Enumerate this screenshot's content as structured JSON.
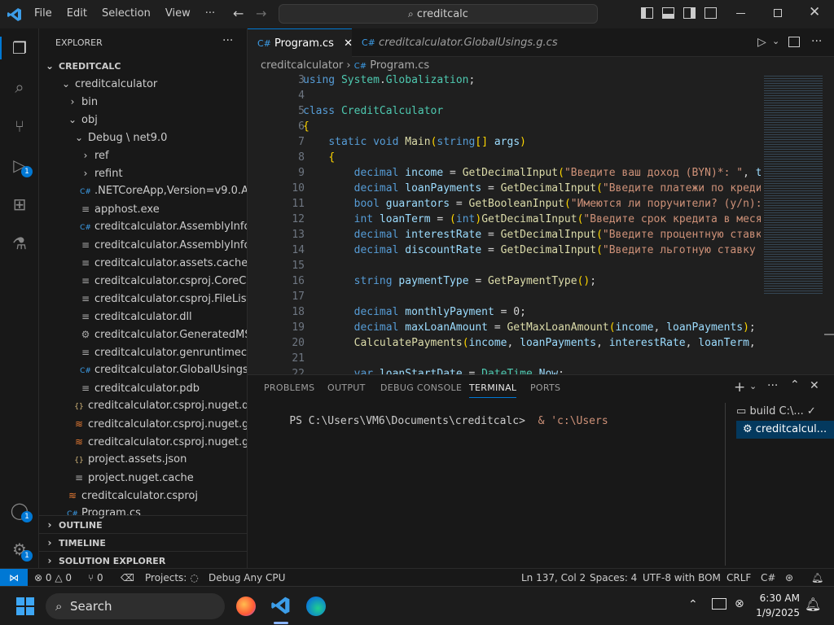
{
  "menu": {
    "file": "File",
    "edit": "Edit",
    "selection": "Selection",
    "view": "View",
    "more": "···"
  },
  "search": {
    "text": "creditcalc"
  },
  "explorer": {
    "title": "EXPLORER",
    "root": "CREDITCALC",
    "items": [
      {
        "label": "creditcalculator",
        "icon": "chevron-down-icon",
        "glyph": "⌄"
      },
      {
        "label": "bin",
        "icon": "chevron-right-icon",
        "glyph": "›"
      },
      {
        "label": "obj",
        "icon": "chevron-down-icon",
        "glyph": "⌄"
      },
      {
        "label": "Debug \\ net9.0",
        "icon": "chevron-down-icon",
        "glyph": "⌄"
      },
      {
        "label": "ref",
        "icon": "chevron-right-icon",
        "glyph": "›"
      },
      {
        "label": "refint",
        "icon": "chevron-right-icon",
        "glyph": "›"
      },
      {
        "label": ".NETCoreApp,Version=v9.0.Asse...",
        "icon": "csharp-file-icon",
        "glyph": "C#"
      },
      {
        "label": "apphost.exe",
        "icon": "file-icon",
        "glyph": "≡"
      },
      {
        "label": "creditcalculator.AssemblyInfo.cs",
        "icon": "csharp-file-icon",
        "glyph": "C#"
      },
      {
        "label": "creditcalculator.AssemblyInfoInp...",
        "icon": "file-icon",
        "glyph": "≡"
      },
      {
        "label": "creditcalculator.assets.cache",
        "icon": "file-icon",
        "glyph": "≡"
      },
      {
        "label": "creditcalculator.csproj.CoreCom...",
        "icon": "file-icon",
        "glyph": "≡"
      },
      {
        "label": "creditcalculator.csproj.FileListAb...",
        "icon": "file-icon",
        "glyph": "≡"
      },
      {
        "label": "creditcalculator.dll",
        "icon": "file-icon",
        "glyph": "≡"
      },
      {
        "label": "creditcalculator.GeneratedMSBui...",
        "icon": "gear-icon",
        "glyph": "⚙"
      },
      {
        "label": "creditcalculator.genruntimeconfi...",
        "icon": "file-icon",
        "glyph": "≡"
      },
      {
        "label": "creditcalculator.GlobalUsings.g.cs",
        "icon": "csharp-file-icon",
        "glyph": "C#"
      },
      {
        "label": "creditcalculator.pdb",
        "icon": "file-icon",
        "glyph": "≡"
      },
      {
        "label": "creditcalculator.csproj.nuget.dgsp...",
        "icon": "json-icon",
        "glyph": "{}"
      },
      {
        "label": "creditcalculator.csproj.nuget.g.pro...",
        "icon": "rss-icon",
        "glyph": "≋"
      },
      {
        "label": "creditcalculator.csproj.nuget.g.tar...",
        "icon": "rss-icon",
        "glyph": "≋"
      },
      {
        "label": "project.assets.json",
        "icon": "json-icon",
        "glyph": "{}"
      },
      {
        "label": "project.nuget.cache",
        "icon": "file-icon",
        "glyph": "≡"
      },
      {
        "label": "creditcalculator.csproj",
        "icon": "rss-icon",
        "glyph": "≋"
      },
      {
        "label": "Program.cs",
        "icon": "csharp-file-icon",
        "glyph": "C#"
      }
    ],
    "sections": [
      "OUTLINE",
      "TIMELINE",
      "SOLUTION EXPLORER"
    ]
  },
  "tabs": [
    {
      "label": "Program.cs",
      "active": true
    },
    {
      "label": "creditcalculator.GlobalUsings.g.cs",
      "active": false
    }
  ],
  "breadcrumb": {
    "folder": "creditcalculator",
    "sep": "›",
    "file": "Program.cs"
  },
  "code": [
    {
      "n": "3",
      "t": "using System.Globalization;"
    },
    {
      "n": "4",
      "t": ""
    },
    {
      "n": "5",
      "t": "class CreditCalculator"
    },
    {
      "n": "6",
      "t": "{"
    },
    {
      "n": "7",
      "t": "    static void Main(string[] args)"
    },
    {
      "n": "8",
      "t": "    {"
    },
    {
      "n": "9",
      "t": "        decimal income = GetDecimalInput(\"Введите ваш доход (BYN)*: \", t"
    },
    {
      "n": "10",
      "t": "        decimal loanPayments = GetDecimalInput(\"Введите платежи по креди"
    },
    {
      "n": "11",
      "t": "        bool guarantors = GetBooleanInput(\"Имеются ли поручители? (y/n):"
    },
    {
      "n": "12",
      "t": "        int loanTerm = (int)GetDecimalInput(\"Введите срок кредита в меся"
    },
    {
      "n": "13",
      "t": "        decimal interestRate = GetDecimalInput(\"Введите процентную ставку"
    },
    {
      "n": "14",
      "t": "        decimal discountRate = GetDecimalInput(\"Введите льготную ставку"
    },
    {
      "n": "15",
      "t": ""
    },
    {
      "n": "16",
      "t": "        string paymentType = GetPaymentType();"
    },
    {
      "n": "17",
      "t": ""
    },
    {
      "n": "18",
      "t": "        decimal monthlyPayment = 0;"
    },
    {
      "n": "19",
      "t": "        decimal maxLoanAmount = GetMaxLoanAmount(income, loanPayments);"
    },
    {
      "n": "20",
      "t": "        CalculatePayments(income, loanPayments, interestRate, loanTerm,"
    },
    {
      "n": "21",
      "t": ""
    },
    {
      "n": "22",
      "t": "        var loanStartDate = DateTime.Now;"
    }
  ],
  "panel": {
    "tabs": [
      "PROBLEMS",
      "OUTPUT",
      "DEBUG CONSOLE",
      "TERMINAL",
      "PORTS"
    ],
    "active": "TERMINAL",
    "terminal_prompt": "PS C:\\Users\\VM6\\Documents\\creditcalc>",
    "terminal_cmd": "& 'c:\\Users",
    "terminals": [
      "build C:\\...",
      "creditcalcul..."
    ]
  },
  "status": {
    "errors": "0",
    "warnings": "0",
    "ports": "0",
    "projects": "Projects:",
    "config": "Debug Any CPU",
    "position": "Ln 137, Col 2",
    "spaces": "Spaces: 4",
    "encoding": "UTF-8 with BOM",
    "eol": "CRLF",
    "lang": "C#"
  },
  "taskbar": {
    "search": "Search",
    "time": "6:30 AM",
    "date": "1/9/2025"
  },
  "badges": {
    "debug": "1",
    "accounts": "1",
    "manage": "1"
  },
  "colors": {
    "accent": "#0078d4",
    "activity_bg": "#181818",
    "editor_bg": "#1f1f1f"
  }
}
